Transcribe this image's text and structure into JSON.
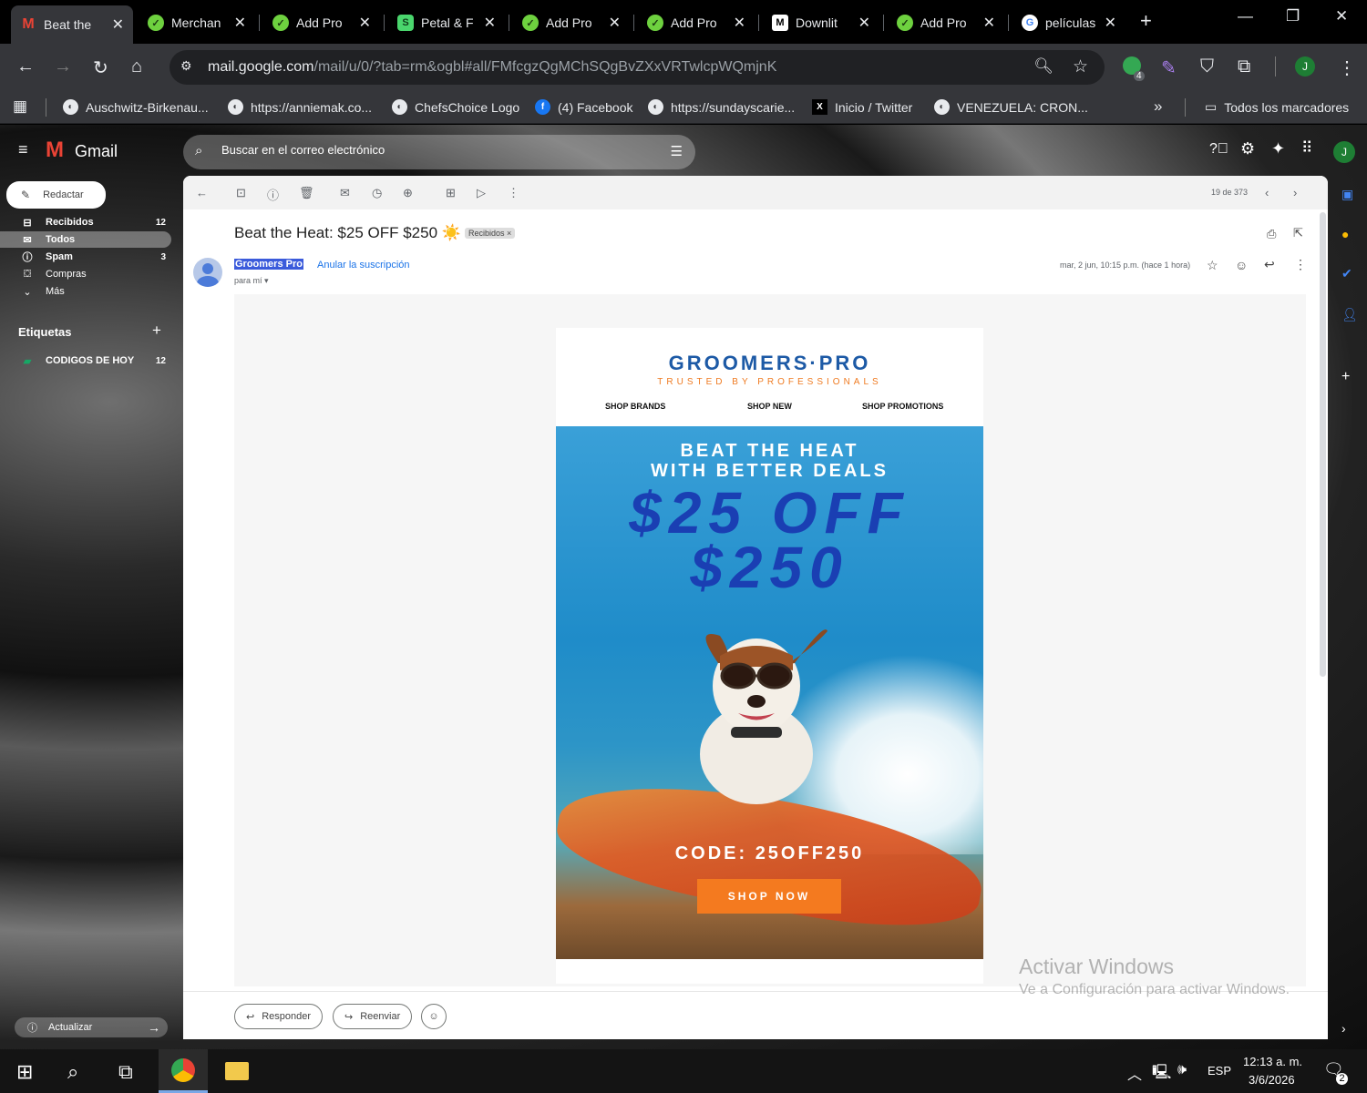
{
  "tabs": [
    {
      "title": "Beat the",
      "icon": "gmail-icon",
      "active": true
    },
    {
      "title": "Merchan",
      "icon": "green-check-icon"
    },
    {
      "title": "Add Pro",
      "icon": "green-check-icon"
    },
    {
      "title": "Petal & F",
      "icon": "shopify-icon"
    },
    {
      "title": "Add Pro",
      "icon": "green-check-icon"
    },
    {
      "title": "Add Pro",
      "icon": "green-check-icon"
    },
    {
      "title": "Downlit",
      "icon": "m-icon"
    },
    {
      "title": "Add Pro",
      "icon": "green-check-icon"
    },
    {
      "title": "películas",
      "icon": "google-icon"
    }
  ],
  "omnibox": {
    "host": "mail.google.com",
    "path": "/mail/u/0/?tab=rm&ogbl#all/FMfcgzQgMChSQgBvZXxVRTwlcpWQmjnK"
  },
  "extensions": {
    "badge": "4",
    "profile_letter": "J"
  },
  "bookmarks": [
    "Auschwitz-Birkenau...",
    "https://anniemak.co...",
    "ChefsChoice Logo",
    "(4) Facebook",
    "https://sundayscarie...",
    "Inicio / Twitter",
    "VENEZUELA: CRON..."
  ],
  "bookmarks_all": "Todos los marcadores",
  "gmail": {
    "brand": "Gmail",
    "search_placeholder": "Buscar en el correo electrónico",
    "compose": "Redactar",
    "nav": [
      {
        "label": "Recibidos",
        "count": "12"
      },
      {
        "label": "Todos",
        "count": ""
      },
      {
        "label": "Spam",
        "count": "3"
      },
      {
        "label": "Compras",
        "count": ""
      },
      {
        "label": "Más",
        "count": ""
      }
    ],
    "labels_header": "Etiquetas",
    "labels": [
      {
        "label": "CODIGOS DE HOY",
        "count": "12"
      }
    ],
    "update": "Actualizar",
    "pager": "19 de 373"
  },
  "email": {
    "subject": "Beat the Heat: $25 OFF $250 ☀️",
    "chip": "Recibidos",
    "sender": "Groomers Pro",
    "unsubscribe": "Anular la suscripción",
    "to": "para mí",
    "date": "mar, 2 jun, 10:15 p.m. (hace 1 hora)",
    "reply": "Responder",
    "forward": "Reenviar"
  },
  "newsletter": {
    "logo_main": "GROOMERS·PRO",
    "logo_sub": "TRUSTED BY PROFESSIONALS",
    "nav": [
      "SHOP BRANDS",
      "SHOP NEW",
      "SHOP PROMOTIONS"
    ],
    "headline1": "BEAT THE HEAT",
    "headline2": "WITH BETTER DEALS",
    "offer1": "$25 OFF",
    "offer2": "$250",
    "code": "CODE: 25OFF250",
    "cta": "SHOP NOW"
  },
  "watermark": {
    "title": "Activar Windows",
    "sub": "Ve a Configuración para activar Windows."
  },
  "taskbar": {
    "lang": "ESP",
    "time": "12:13 a. m.",
    "date": "3/6/2026",
    "notif": "2"
  },
  "colors": {
    "gmail_red": "#ea4335",
    "accent_blue": "#1a73e8",
    "cta_orange": "#f47a1f",
    "logo_blue": "#1d5aa6",
    "logo_orange": "#ef7b22"
  }
}
